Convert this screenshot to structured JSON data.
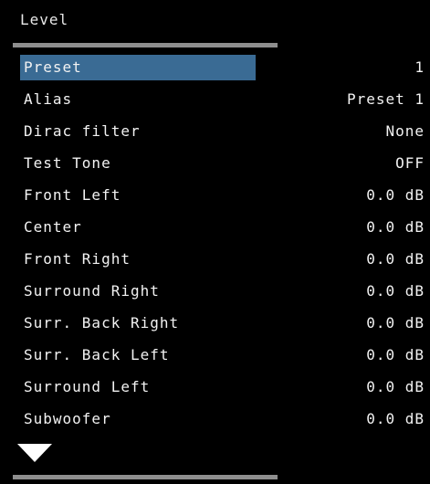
{
  "header": {
    "title": "Level"
  },
  "menu": {
    "items": [
      {
        "label": "Preset",
        "value": "1"
      },
      {
        "label": "Alias",
        "value": "Preset 1"
      },
      {
        "label": "Dirac filter",
        "value": "None"
      },
      {
        "label": "Test Tone",
        "value": "OFF"
      },
      {
        "label": "Front Left",
        "value": "0.0 dB"
      },
      {
        "label": "Center",
        "value": "0.0 dB"
      },
      {
        "label": "Front Right",
        "value": "0.0 dB"
      },
      {
        "label": "Surround Right",
        "value": "0.0 dB"
      },
      {
        "label": "Surr. Back Right",
        "value": "0.0 dB"
      },
      {
        "label": "Surr. Back Left",
        "value": "0.0 dB"
      },
      {
        "label": "Surround Left",
        "value": "0.0 dB"
      },
      {
        "label": "Subwoofer",
        "value": "0.0 dB"
      }
    ]
  },
  "icons": {
    "more": "triangle-down-icon"
  },
  "colors": {
    "background": "#000000",
    "text": "#f2f2f2",
    "selection": "#3a6b94",
    "divider": "#8e8e8e"
  }
}
